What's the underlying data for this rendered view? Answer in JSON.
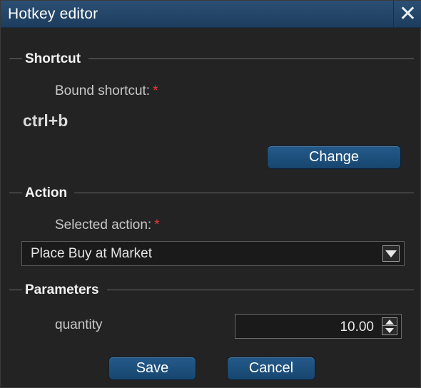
{
  "window": {
    "title": "Hotkey editor",
    "close_icon": "close-icon"
  },
  "shortcut": {
    "section_label": "Shortcut",
    "field_label": "Bound shortcut:",
    "required_marker": "*",
    "value": "ctrl+b",
    "change_label": "Change"
  },
  "action": {
    "section_label": "Action",
    "field_label": "Selected action:",
    "required_marker": "*",
    "selected_value": "Place Buy at Market",
    "dropdown_icon": "chevron-down-icon"
  },
  "parameters": {
    "section_label": "Parameters",
    "quantity_label": "quantity",
    "quantity_value": "10.00"
  },
  "footer": {
    "save_label": "Save",
    "cancel_label": "Cancel"
  },
  "colors": {
    "titlebar": "#1d3d5e",
    "background": "#232323",
    "button": "#17466f",
    "required": "#e03a3a"
  }
}
